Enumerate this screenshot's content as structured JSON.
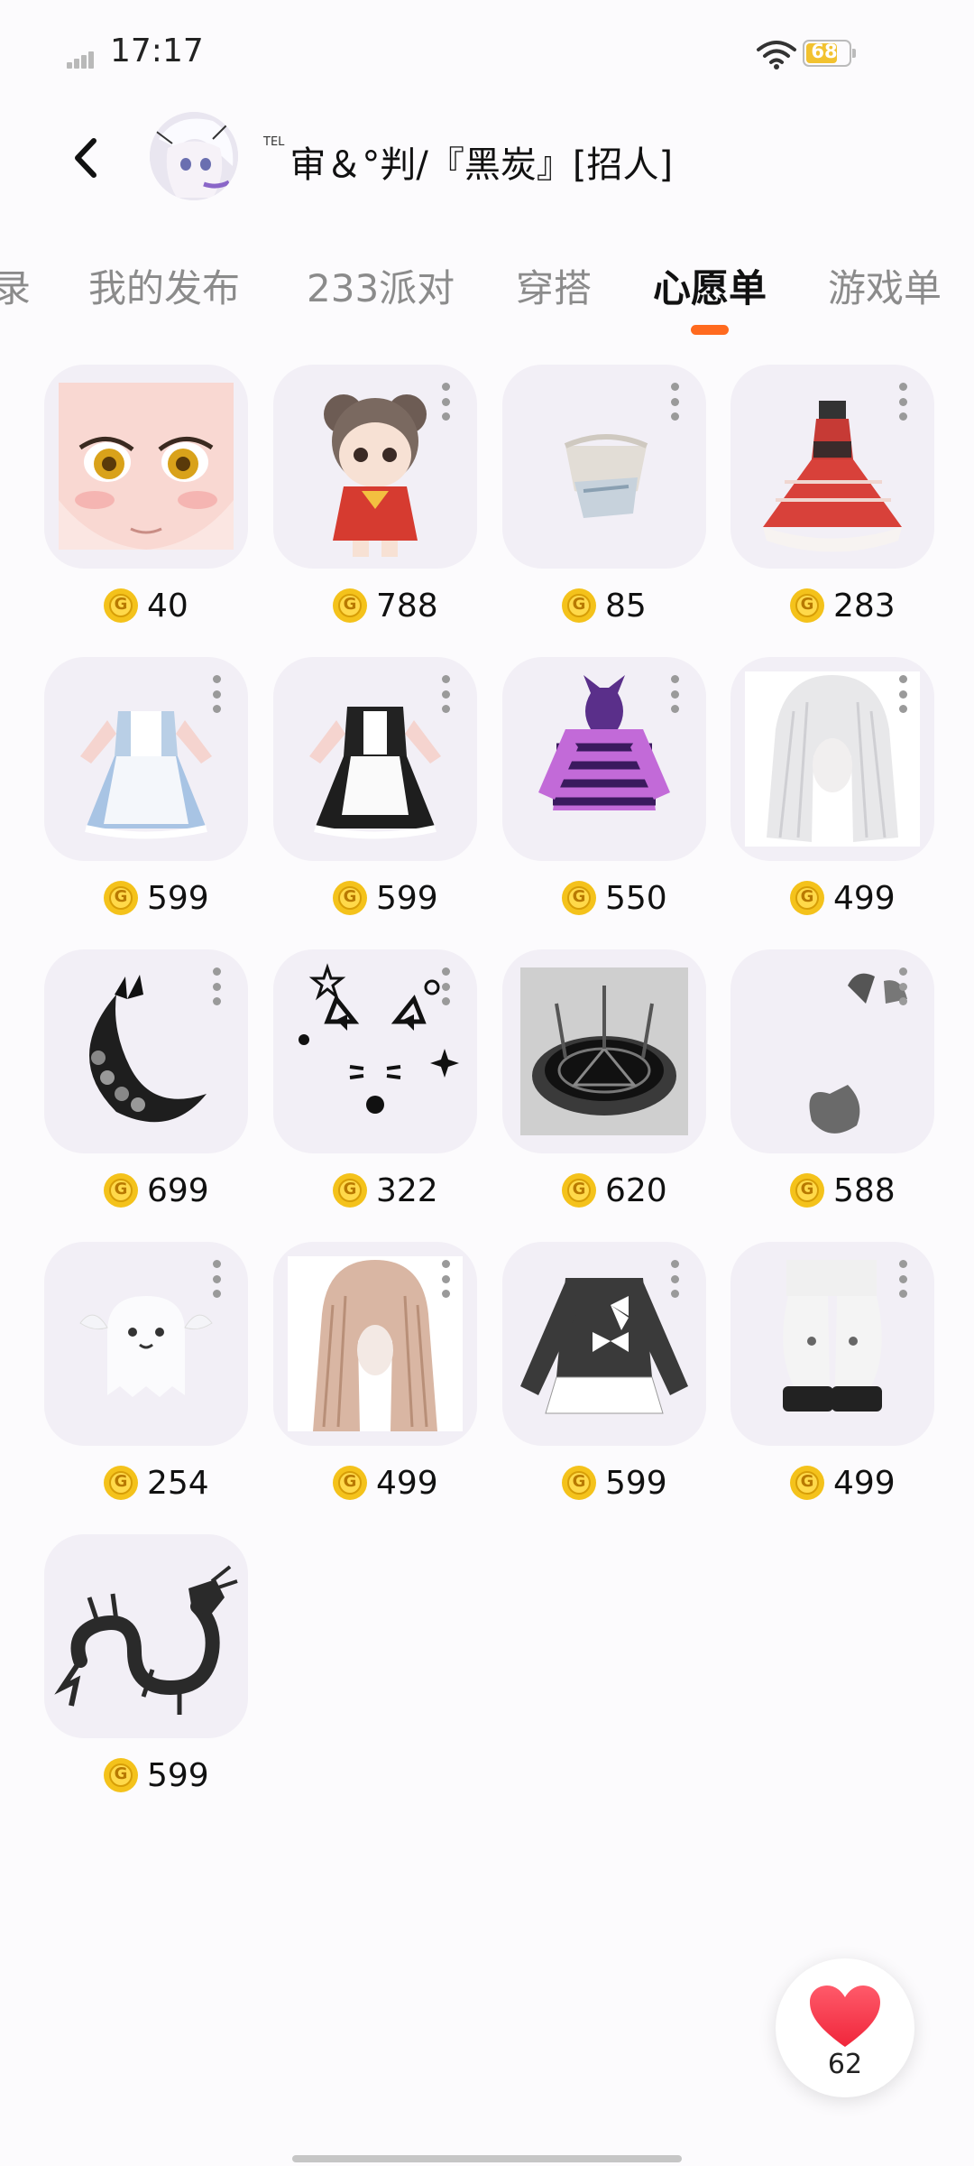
{
  "status_bar": {
    "time": "17:17",
    "battery": "68"
  },
  "header": {
    "tel_badge": "TEL",
    "username": "审＆°判/『黑炭』[招人]"
  },
  "tabs": [
    {
      "label": "录"
    },
    {
      "label": "我的发布"
    },
    {
      "label": "233派对"
    },
    {
      "label": "穿搭"
    },
    {
      "label": "心愿单",
      "active": true
    },
    {
      "label": "游戏单"
    }
  ],
  "coin_symbol": "G",
  "wishlist": [
    {
      "icon": "anime-face",
      "price": "40"
    },
    {
      "icon": "doll-red-outfit",
      "price": "788"
    },
    {
      "icon": "visor-accessory",
      "price": "85"
    },
    {
      "icon": "red-lolita-dress",
      "price": "283"
    },
    {
      "icon": "blue-maid-dress",
      "price": "599"
    },
    {
      "icon": "black-maid-dress",
      "price": "599"
    },
    {
      "icon": "purple-cat-hoodie",
      "price": "550"
    },
    {
      "icon": "white-long-hair",
      "price": "499"
    },
    {
      "icon": "crescent-moon-butterfly",
      "price": "699"
    },
    {
      "icon": "cat-face-stickers",
      "price": "322"
    },
    {
      "icon": "magic-circle",
      "price": "620"
    },
    {
      "icon": "ears-and-tail",
      "price": "588"
    },
    {
      "icon": "ghost-with-wings",
      "price": "254"
    },
    {
      "icon": "pink-long-hair",
      "price": "499"
    },
    {
      "icon": "black-bow-sweater",
      "price": "599"
    },
    {
      "icon": "fluffy-leg-warmers",
      "price": "499"
    },
    {
      "icon": "black-dragon",
      "price": "599"
    }
  ],
  "fab": {
    "icon": "heart-icon",
    "count": "62"
  },
  "colors": {
    "accent": "#ff6a1f",
    "coin": "#f4c21b",
    "card_bg": "#f2eff6"
  }
}
